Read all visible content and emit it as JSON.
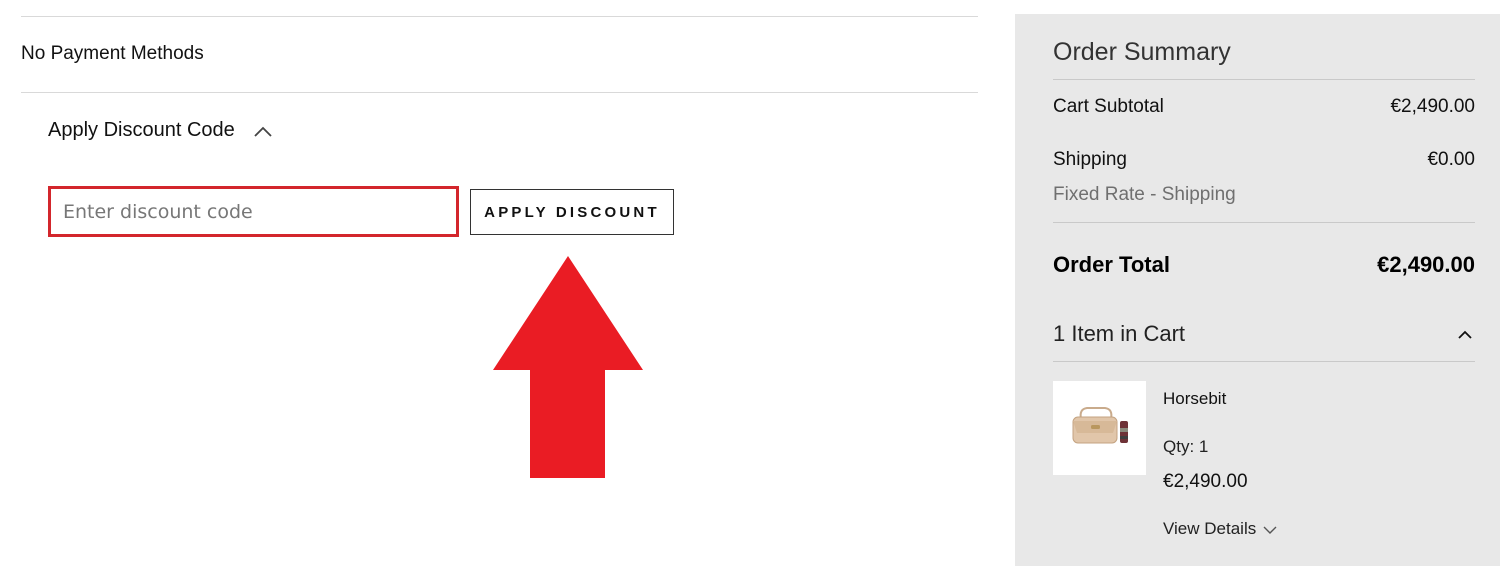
{
  "payment": {
    "no_methods_text": "No Payment Methods"
  },
  "discount": {
    "toggle_label": "Apply Discount Code",
    "toggle_icon": "chevron-up-icon",
    "input_value": "",
    "input_placeholder": "Enter discount code",
    "button_label": "APPLY DISCOUNT",
    "highlight_color": "#d3262c",
    "annotation_arrow_color": "#ea1c24"
  },
  "summary": {
    "title": "Order Summary",
    "subtotal_label": "Cart Subtotal",
    "subtotal_value": "€2,490.00",
    "shipping_label": "Shipping",
    "shipping_value": "€0.00",
    "shipping_method": "Fixed Rate - Shipping",
    "total_label": "Order Total",
    "total_value": "€2,490.00",
    "background_color": "#e8e8e8",
    "items_header": "1 Item in Cart",
    "items_toggle_icon": "chevron-up-icon",
    "items": [
      {
        "name": "Horsebit",
        "qty": "Qty: 1",
        "price": "€2,490.00",
        "details_label": "View Details",
        "details_icon": "chevron-down-icon",
        "image": "handbag-thumbnail"
      }
    ]
  }
}
